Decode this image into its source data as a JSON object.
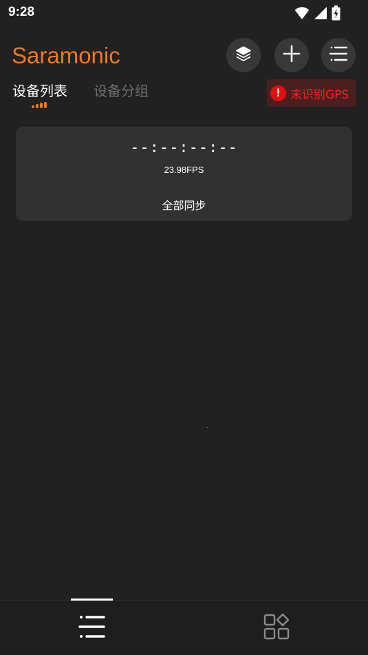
{
  "status_bar": {
    "time": "9:28",
    "icons": [
      "wifi-icon",
      "signal-icon",
      "battery-charging-icon"
    ]
  },
  "header": {
    "brand": "Saramonic",
    "brand_color": "#f0781e",
    "actions": [
      "layers-icon",
      "add-icon",
      "menu-icon"
    ]
  },
  "tabs": {
    "items": [
      {
        "label": "设备列表",
        "active": true
      },
      {
        "label": "设备分组",
        "active": false
      }
    ]
  },
  "gps_status": {
    "icon": "alert-icon",
    "text": "未识别GPS",
    "color": "#ff2020"
  },
  "sync_card": {
    "timecode": "--:--:--:--",
    "fps": "23.98FPS",
    "action_label": "全部同步"
  },
  "bottom_nav": {
    "items": [
      {
        "icon": "list-icon",
        "active": true
      },
      {
        "icon": "apps-grid-icon",
        "active": false
      }
    ]
  }
}
